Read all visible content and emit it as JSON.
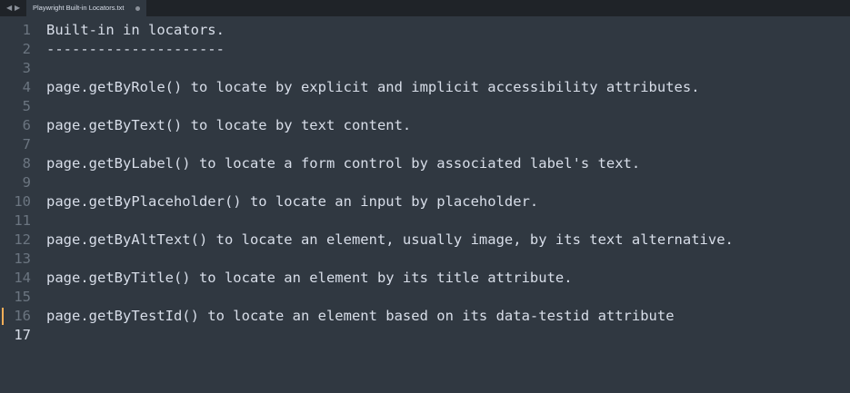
{
  "tabbar": {
    "nav_back": "◀",
    "nav_forward": "▶",
    "active_tab_label": "Playwright Built-in Locators.txt"
  },
  "editor": {
    "current_line": 17,
    "modified_line": 16,
    "lines": [
      {
        "number": "1",
        "text": "Built-in in locators."
      },
      {
        "number": "2",
        "text": "---------------------"
      },
      {
        "number": "3",
        "text": ""
      },
      {
        "number": "4",
        "text": "page.getByRole() to locate by explicit and implicit accessibility attributes."
      },
      {
        "number": "5",
        "text": ""
      },
      {
        "number": "6",
        "text": "page.getByText() to locate by text content."
      },
      {
        "number": "7",
        "text": ""
      },
      {
        "number": "8",
        "text": "page.getByLabel() to locate a form control by associated label's text."
      },
      {
        "number": "9",
        "text": ""
      },
      {
        "number": "10",
        "text": "page.getByPlaceholder() to locate an input by placeholder."
      },
      {
        "number": "11",
        "text": ""
      },
      {
        "number": "12",
        "text": "page.getByAltText() to locate an element, usually image, by its text alternative."
      },
      {
        "number": "13",
        "text": ""
      },
      {
        "number": "14",
        "text": "page.getByTitle() to locate an element by its title attribute."
      },
      {
        "number": "15",
        "text": ""
      },
      {
        "number": "16",
        "text": "page.getByTestId() to locate an element based on its data-testid attribute"
      },
      {
        "number": "17",
        "text": ""
      }
    ]
  },
  "colors": {
    "background": "#303841",
    "tabbar": "#1f2328",
    "text": "#d8dee9",
    "gutter": "#6b7580",
    "modified_marker": "#f9ae58"
  }
}
